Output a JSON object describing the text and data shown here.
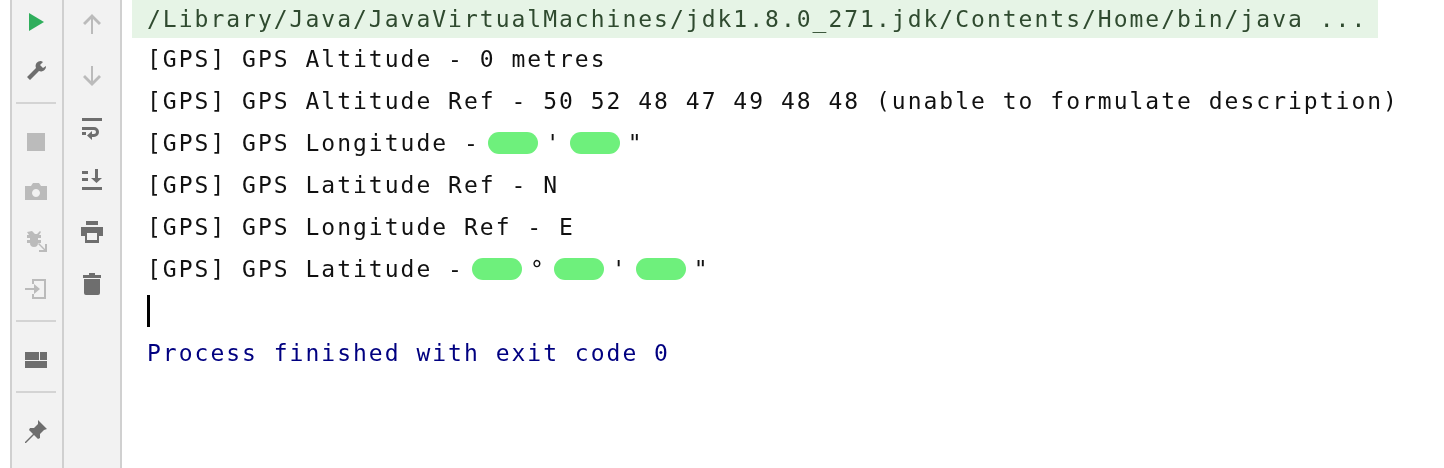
{
  "left_toolbar": [
    {
      "kind": "run",
      "disabled": false
    },
    {
      "kind": "wrench",
      "disabled": false
    },
    {
      "kind": "separator"
    },
    {
      "kind": "stop",
      "disabled": true
    },
    {
      "kind": "camera",
      "disabled": true
    },
    {
      "kind": "bug",
      "disabled": true
    },
    {
      "kind": "enter",
      "disabled": true
    },
    {
      "kind": "separator"
    },
    {
      "kind": "layout",
      "disabled": false
    },
    {
      "kind": "separator"
    },
    {
      "kind": "pin",
      "disabled": false
    }
  ],
  "right_toolbar": [
    {
      "kind": "up",
      "disabled": true
    },
    {
      "kind": "down",
      "disabled": true
    },
    {
      "kind": "wrap",
      "disabled": false
    },
    {
      "kind": "scroll",
      "disabled": false
    },
    {
      "kind": "print",
      "disabled": false
    },
    {
      "kind": "trash",
      "disabled": false
    }
  ],
  "console": {
    "command": "/Library/Java/JavaVirtualMachines/jdk1.8.0_271.jdk/Contents/Home/bin/java ...",
    "lines": [
      {
        "segments": [
          {
            "kind": "text",
            "text": "[GPS] GPS Altitude - 0 metres"
          }
        ]
      },
      {
        "segments": [
          {
            "kind": "text",
            "text": "[GPS] GPS Altitude Ref - 50 52 48 47 49 48 48 (unable to formulate description)"
          }
        ]
      },
      {
        "segments": [
          {
            "kind": "text",
            "text": "[GPS] GPS Longitude - "
          },
          {
            "kind": "redacted"
          },
          {
            "kind": "text",
            "text": "'"
          },
          {
            "kind": "redacted"
          },
          {
            "kind": "text",
            "text": "\""
          }
        ]
      },
      {
        "segments": [
          {
            "kind": "text",
            "text": "[GPS] GPS Latitude Ref - N"
          }
        ]
      },
      {
        "segments": [
          {
            "kind": "text",
            "text": "[GPS] GPS Longitude Ref - E"
          }
        ]
      },
      {
        "segments": [
          {
            "kind": "text",
            "text": "[GPS] GPS Latitude - "
          },
          {
            "kind": "redacted"
          },
          {
            "kind": "text",
            "text": "°"
          },
          {
            "kind": "redacted"
          },
          {
            "kind": "text",
            "text": "'"
          },
          {
            "kind": "redacted"
          },
          {
            "kind": "text",
            "text": "\""
          }
        ]
      }
    ],
    "exit_message": "Process finished with exit code 0"
  }
}
